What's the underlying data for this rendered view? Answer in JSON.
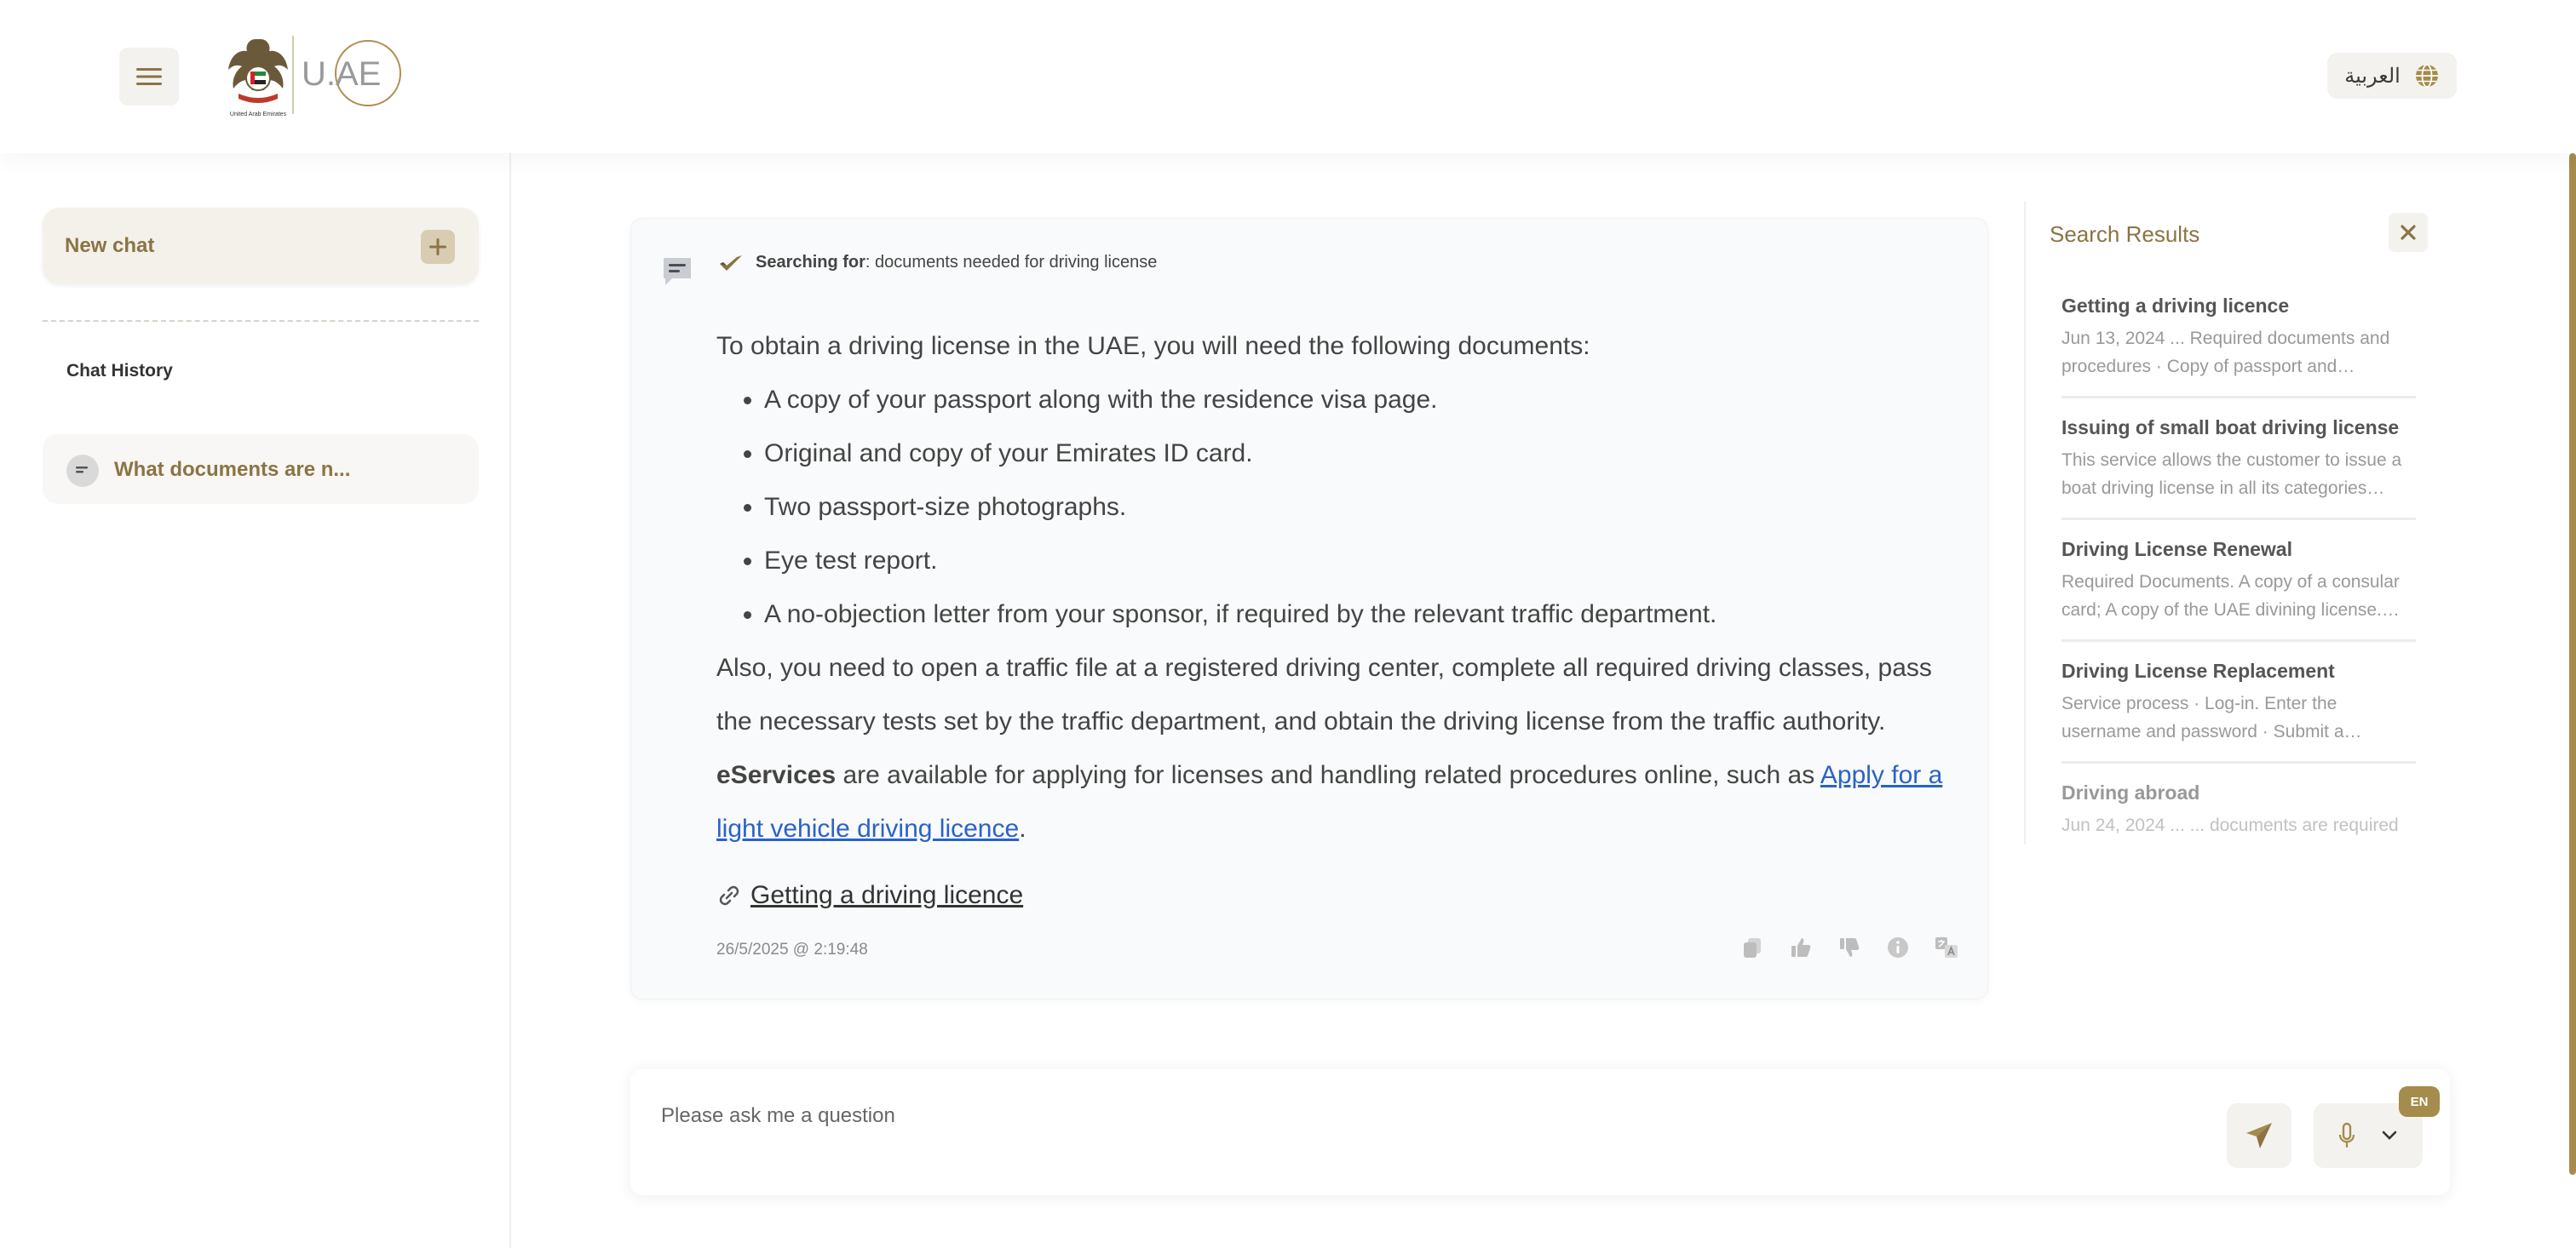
{
  "header": {
    "logo_text": "U.AE",
    "emblem_caption": "United Arab Emirates",
    "language_label": "العربية"
  },
  "sidebar": {
    "new_chat_label": "New chat",
    "history_title": "Chat History",
    "history_items": [
      {
        "label": "What documents are n..."
      }
    ]
  },
  "message": {
    "searching_label": "Searching for",
    "searching_query": ": documents needed for driving license",
    "intro": "To obtain a driving license in the UAE, you will need the following documents:",
    "bullets": [
      "A copy of your passport along with the residence visa page.",
      "Original and copy of your Emirates ID card.",
      "Two passport-size photographs.",
      "Eye test report.",
      "A no-objection letter from your sponsor, if required by the relevant traffic department."
    ],
    "paragraph_before": "Also, you need to open a traffic file at a registered driving center, complete all required driving classes, pass the necessary tests set by the traffic department, and obtain the driving license from the traffic authority. ",
    "paragraph_bold": "eServices",
    "paragraph_after": " are available for applying for licenses and handling related procedures online, such as ",
    "paragraph_link": "Apply for a light vehicle driving licence",
    "paragraph_end": ".",
    "source_link": " Getting a driving licence",
    "timestamp": "26/5/2025 @ 2:19:48"
  },
  "search_results": {
    "title": "Search Results",
    "items": [
      {
        "title": "Getting a driving licence",
        "snippet": "Jun 13, 2024 ... Required documents and procedures · Copy of passport and…"
      },
      {
        "title": "Issuing of small boat driving license",
        "snippet": "This service allows the customer to issue a boat driving license in all its categories…"
      },
      {
        "title": "Driving License Renewal",
        "snippet": "Required Documents. A copy of a consular card; A copy of the UAE divining license.…"
      },
      {
        "title": "Driving License Replacement",
        "snippet": "Service process · Log-in. Enter the username and password · Submit a…"
      },
      {
        "title": "Driving abroad",
        "snippet": "Jun 24, 2024 ... ... documents are required"
      }
    ]
  },
  "input": {
    "placeholder": "Please ask me a question",
    "language_badge": "EN"
  },
  "colors": {
    "accent": "#8b7444",
    "badge": "#a58b4c",
    "link": "#2a62c8"
  }
}
